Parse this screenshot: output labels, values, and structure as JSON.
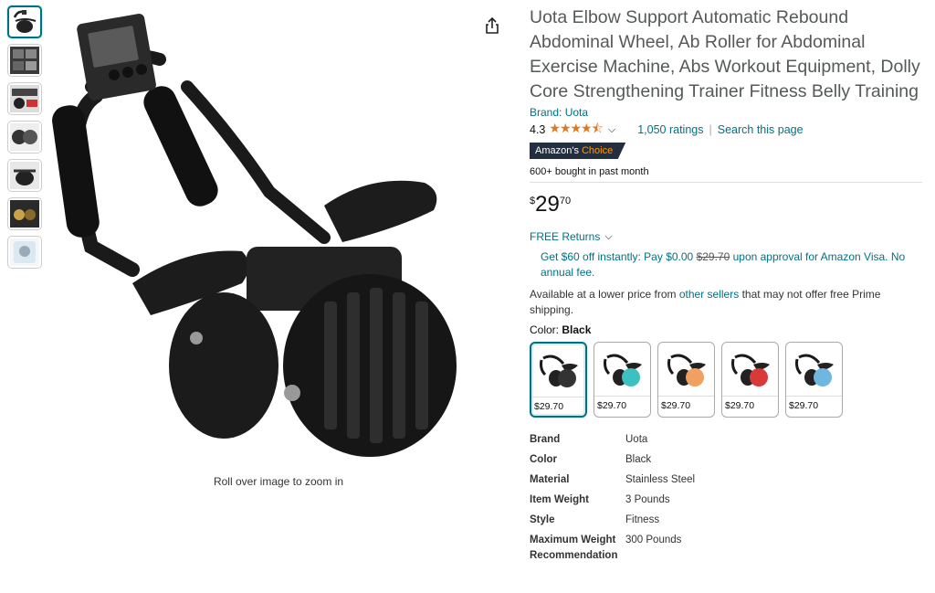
{
  "product": {
    "title": "Uota Elbow Support Automatic Rebound Abdominal Wheel, Ab Roller for Abdominal Exercise Machine, Abs Workout Equipment, Dolly Core Strengthening Trainer Fitness Belly Training",
    "brand_link": "Brand: Uota",
    "rating": "4.3",
    "stars": "★★★★⯪",
    "ratings_count": "1,050 ratings",
    "search_page": "Search this page",
    "badge_prefix": "Amazon's",
    "badge_choice": "Choice",
    "bought": "600+ bought in past month",
    "price": {
      "currency": "$",
      "whole": "29",
      "fraction": "70"
    },
    "returns": "FREE Returns",
    "promo": {
      "before": "Get $60 off instantly: Pay $0.00 ",
      "strike": "$29.70",
      "after": " upon approval for Amazon Visa. No annual fee."
    },
    "lower_price": {
      "before": "Available at a lower price from ",
      "link": "other sellers",
      "after": " that may not offer free Prime shipping."
    },
    "color_label": "Color: ",
    "color_value": "Black",
    "zoom_hint": "Roll over image to zoom in"
  },
  "swatches": [
    {
      "price": "$29.70",
      "accent": "#333333"
    },
    {
      "price": "$29.70",
      "accent": "#3cc0c0"
    },
    {
      "price": "$29.70",
      "accent": "#f0a060"
    },
    {
      "price": "$29.70",
      "accent": "#d83a3a"
    },
    {
      "price": "$29.70",
      "accent": "#6fb6e0"
    }
  ],
  "specs": [
    {
      "key": "Brand",
      "value": "Uota"
    },
    {
      "key": "Color",
      "value": "Black"
    },
    {
      "key": "Material",
      "value": "Stainless Steel"
    },
    {
      "key": "Item Weight",
      "value": "3 Pounds"
    },
    {
      "key": "Style",
      "value": "Fitness"
    },
    {
      "key": "Maximum Weight Recommendation",
      "value": "300 Pounds"
    }
  ],
  "icons": {
    "share": "share-icon",
    "chevron": "chevron-down-icon"
  },
  "colors": {
    "link": "#007185",
    "star": "#de7921",
    "badge": "#232f3e",
    "badge_accent": "#ff9900"
  }
}
